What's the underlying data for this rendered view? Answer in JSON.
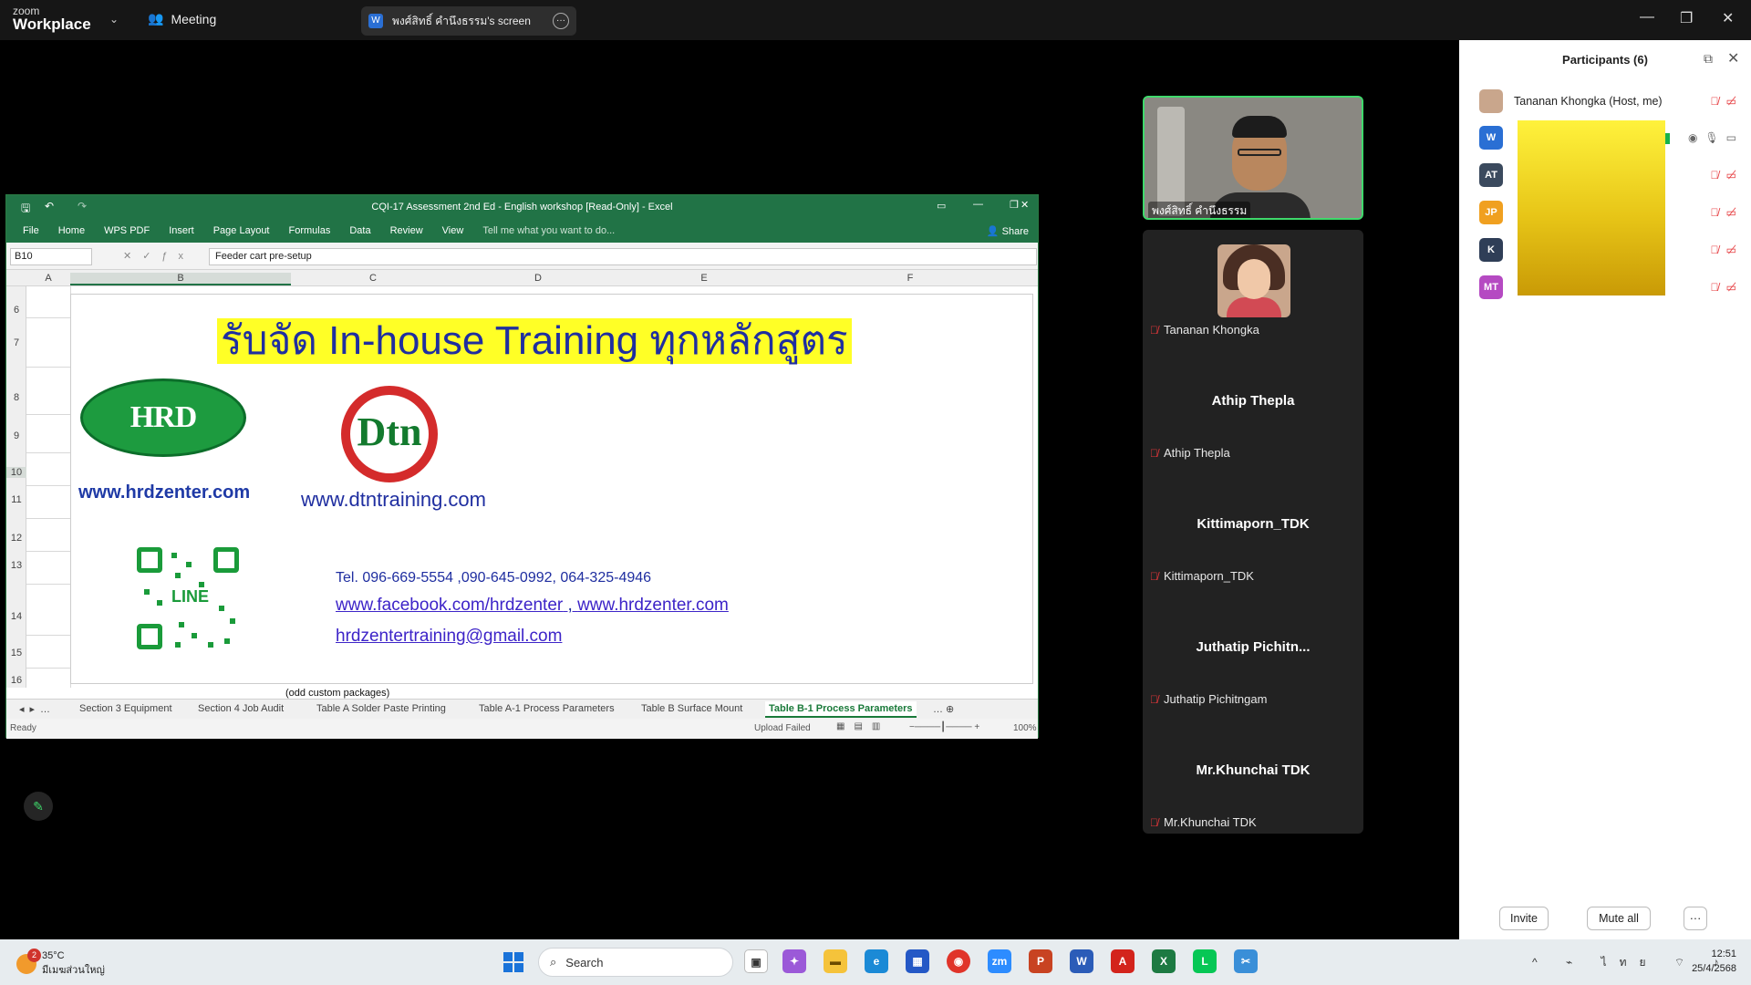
{
  "zoom": {
    "brand_small": "zoom",
    "brand_big": "Workplace",
    "meeting_label": "Meeting",
    "screen_pill_avatar": "W",
    "screen_pill_label": "พงศ์สิทธิ์ คำนึงธรรม's screen",
    "window_controls": [
      "—",
      "❐",
      "✕"
    ]
  },
  "excel": {
    "title": "CQI-17 Assessment 2nd Ed - English workshop  [Read-Only] - Excel",
    "ribbon_tabs": [
      "File",
      "Home",
      "WPS PDF",
      "Insert",
      "Page Layout",
      "Formulas",
      "Data",
      "Review",
      "View"
    ],
    "tell_me": "Tell me what you want to do...",
    "share": "Share",
    "name_box": "B10",
    "formula": "Feeder cart pre-setup",
    "columns": [
      "A",
      "B",
      "C",
      "D",
      "E",
      "F"
    ],
    "rows": [
      "6",
      "7",
      "8",
      "9",
      "10",
      "11",
      "12",
      "13",
      "14",
      "15",
      "16"
    ],
    "cell_b16": "(odd custom packages)",
    "sheet_tabs": [
      "Section 3 Equipment",
      "Section 4 Job Audit",
      "Table A Solder Paste Printing",
      "Table A-1 Process Parameters",
      "Table B Surface Mount",
      "Table B-1 Process Parameters"
    ],
    "status_ready": "Ready",
    "status_upload": "Upload Failed",
    "zoom_level": "100%"
  },
  "ad": {
    "title": "รับจัด In-house Training ทุกหลักสูตร",
    "hrd_logo": "HRD ZENTER",
    "hrd_url": "www.hrdzenter.com",
    "dtn_logo": "Dtn",
    "dtn_url": "www.dtntraining.com",
    "qr_label": "LINE",
    "tel": "Tel.  096-669-5554 ,090-645-0992, 064-325-4946",
    "fb_link": "www.facebook.com/hrdzenter",
    "fb_sep": " , ",
    "site_link": "www.hrdzenter.com",
    "email": "hrdzentertraining@gmail.com"
  },
  "gallery": {
    "speaker_name": "พงศ์สิทธิ์ คำนึงธรรม",
    "tiles": [
      {
        "big": "",
        "label": "Tananan  Khongka"
      },
      {
        "big": "Athip Thepla",
        "label": "Athip Thepla"
      },
      {
        "big": "Kittimaporn_TDK",
        "label": "Kittimaporn_TDK"
      },
      {
        "big": "Juthatip  Pichitn...",
        "label": "Juthatip Pichitngam"
      },
      {
        "big": "Mr.Khunchai TDK",
        "label": "Mr.Khunchai TDK"
      }
    ]
  },
  "participants": {
    "title": "Participants (6)",
    "list": [
      {
        "initials": "",
        "name": "Tananan  Khongka (Host, me)",
        "color": "#c9a68c"
      },
      {
        "initials": "W",
        "name": "",
        "color": "#2a6fd4"
      },
      {
        "initials": "AT",
        "name": "",
        "color": "#3b4a5e"
      },
      {
        "initials": "JP",
        "name": "",
        "color": "#f0a020"
      },
      {
        "initials": "K",
        "name": "",
        "color": "#2f3e57"
      },
      {
        "initials": "MT",
        "name": "",
        "color": "#b54ac2"
      }
    ],
    "invite": "Invite",
    "mute_all": "Mute all",
    "more": "···"
  },
  "taskbar": {
    "temp": "35°C",
    "weather_desc": "มีเมฆส่วนใหญ่",
    "weather_badge": "2",
    "search": "Search",
    "lang": "ไทย",
    "time": "12:51",
    "date": "25/4/2568"
  }
}
